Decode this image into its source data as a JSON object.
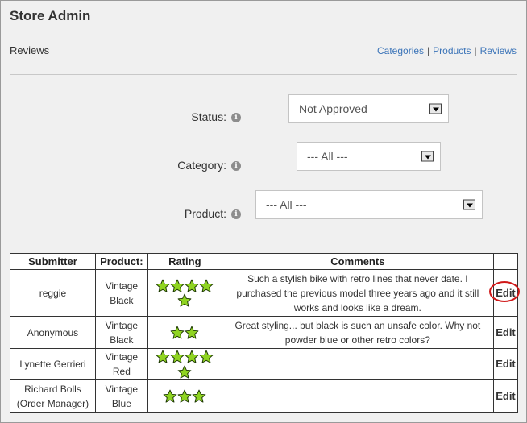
{
  "app": {
    "title": "Store Admin"
  },
  "section_title": "Reviews",
  "nav_links": [
    {
      "label": "Categories"
    },
    {
      "label": "Products"
    },
    {
      "label": "Reviews"
    }
  ],
  "nav_separator": "|",
  "filters": {
    "status": {
      "label": "Status:",
      "value": "Not Approved"
    },
    "category": {
      "label": "Category:",
      "value": "--- All ---"
    },
    "product": {
      "label": "Product:",
      "value": "--- All ---"
    }
  },
  "info_glyph": "i",
  "table": {
    "headers": [
      "Submitter",
      "Product:",
      "Rating",
      "Comments",
      ""
    ],
    "edit_label": "Edit",
    "star_color": "#8fd421",
    "rows": [
      {
        "submitter": "reggie",
        "product": "Vintage Black",
        "rating": 5,
        "comment": "Such a stylish bike with retro lines that never date. I purchased the previous model three years ago and it still works and looks like a dream."
      },
      {
        "submitter": "Anonymous",
        "product": "Vintage Black",
        "rating": 2,
        "comment": "Great styling... but black is such an unsafe color. Why not powder blue or other retro colors?"
      },
      {
        "submitter": "Lynette Gerrieri",
        "product": "Vintage Red",
        "rating": 5,
        "comment": ""
      },
      {
        "submitter": "Richard Bolls (Order Manager)",
        "product": "Vintage Blue",
        "rating": 3,
        "comment": ""
      }
    ]
  }
}
